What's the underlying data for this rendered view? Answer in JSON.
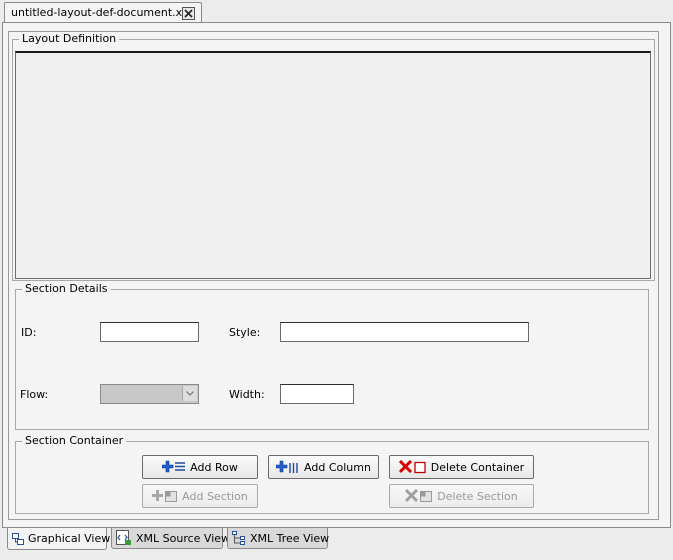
{
  "document_tab": {
    "title": "untitled-layout-def-document.xml"
  },
  "layout_definition": {
    "title": "Layout Definition"
  },
  "section_details": {
    "title": "Section Details",
    "id_label": "ID:",
    "id_value": "",
    "style_label": "Style:",
    "style_value": "",
    "flow_label": "Flow:",
    "flow_value": "",
    "width_label": "Width:",
    "width_value": ""
  },
  "section_container": {
    "title": "Section Container",
    "add_row": "Add Row",
    "add_column": "Add Column",
    "delete_container": "Delete Container",
    "add_section": "Add Section",
    "delete_section": "Delete Section"
  },
  "view_tabs": [
    {
      "label": "Graphical View",
      "active": true
    },
    {
      "label": "XML Source View",
      "active": false
    },
    {
      "label": "XML Tree View",
      "active": false
    }
  ],
  "colors": {
    "plus_blue": "#1f5fd0",
    "delete_red": "#d80000",
    "disabled_gray": "#9a9a9a"
  }
}
